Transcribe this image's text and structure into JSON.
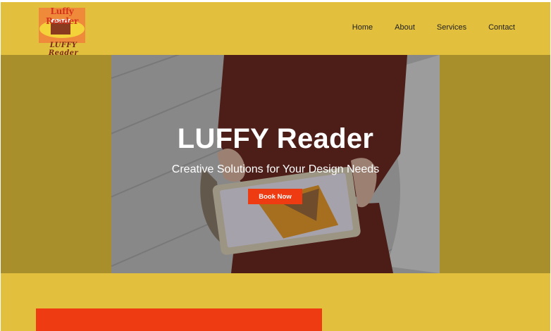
{
  "brand": {
    "logo_top_text": "Luffy Reader",
    "logo_signature": "LUFFY Reader"
  },
  "nav": {
    "items": [
      {
        "label": "Home"
      },
      {
        "label": "About"
      },
      {
        "label": "Services"
      },
      {
        "label": "Contact"
      }
    ]
  },
  "hero": {
    "title": "LUFFY Reader",
    "subtitle": "Creative Solutions for Your Design Needs",
    "cta_label": "Book Now"
  },
  "colors": {
    "header_bg": "#e2bf3d",
    "band_bg": "#a88f2c",
    "accent": "#ef3b12"
  }
}
